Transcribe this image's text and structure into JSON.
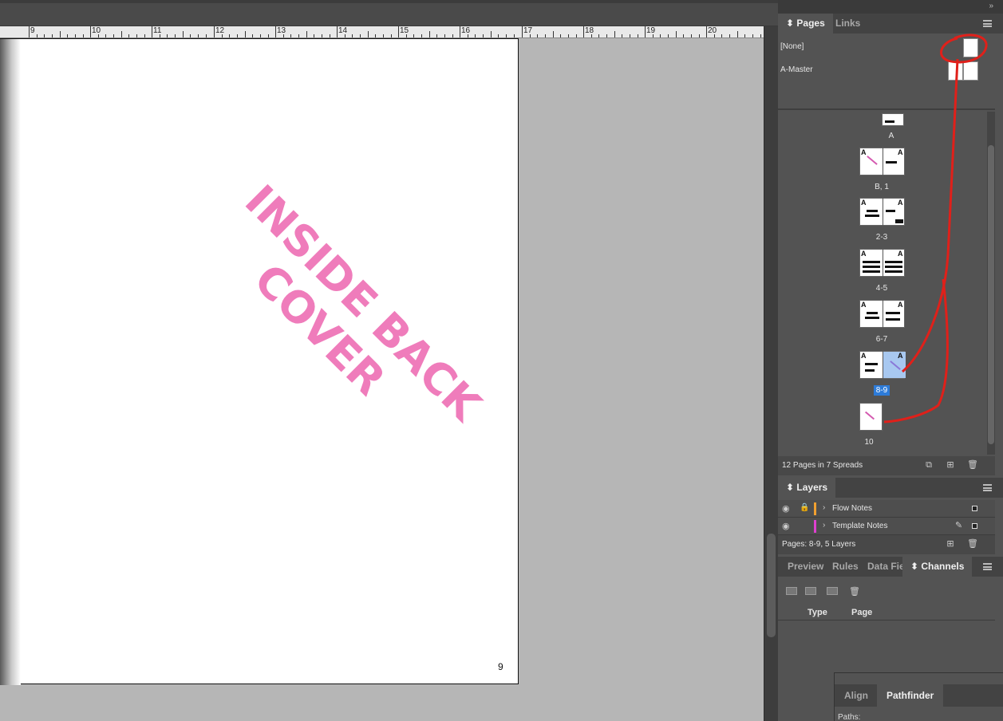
{
  "ruler": {
    "numbers": [
      "9",
      "10",
      "11",
      "12",
      "13",
      "14",
      "15",
      "16",
      "17",
      "18",
      "19",
      "20"
    ]
  },
  "document": {
    "watermark_line1": "INSIDE BACK",
    "watermark_line2": "COVER",
    "page_number": "9"
  },
  "pages_panel": {
    "tabs": [
      {
        "label": "Pages"
      },
      {
        "label": "Links"
      }
    ],
    "masters": [
      {
        "label": "[None]"
      },
      {
        "label": "A-Master"
      }
    ],
    "first_spread_label": "A",
    "spreads": [
      {
        "label": "B, 1"
      },
      {
        "label": "2-3"
      },
      {
        "label": "4-5"
      },
      {
        "label": "6-7"
      },
      {
        "label": "8-9",
        "selected": true
      },
      {
        "label": "10"
      }
    ],
    "footer": "12 Pages in 7 Spreads"
  },
  "layers_panel": {
    "tab": "Layers",
    "layers": [
      {
        "name": "Flow Notes",
        "color": "#f0a030",
        "locked": true
      },
      {
        "name": "Template Notes",
        "color": "#e040d0",
        "locked": false
      }
    ],
    "footer": "Pages: 8-9, 5 Layers"
  },
  "channels_panel": {
    "tabs": [
      {
        "label": "Preview"
      },
      {
        "label": "Rules"
      },
      {
        "label": "Data Fie"
      },
      {
        "label": "Channels"
      }
    ],
    "columns": [
      "Type",
      "Page"
    ]
  },
  "pathfinder_panel": {
    "tabs": [
      {
        "label": "Align"
      },
      {
        "label": "Pathfinder"
      }
    ],
    "paths_label": "Paths:"
  },
  "colors": {
    "annotation": "#e0201a",
    "watermark": "#ef7cbb",
    "selection": "#2d7bd8"
  }
}
